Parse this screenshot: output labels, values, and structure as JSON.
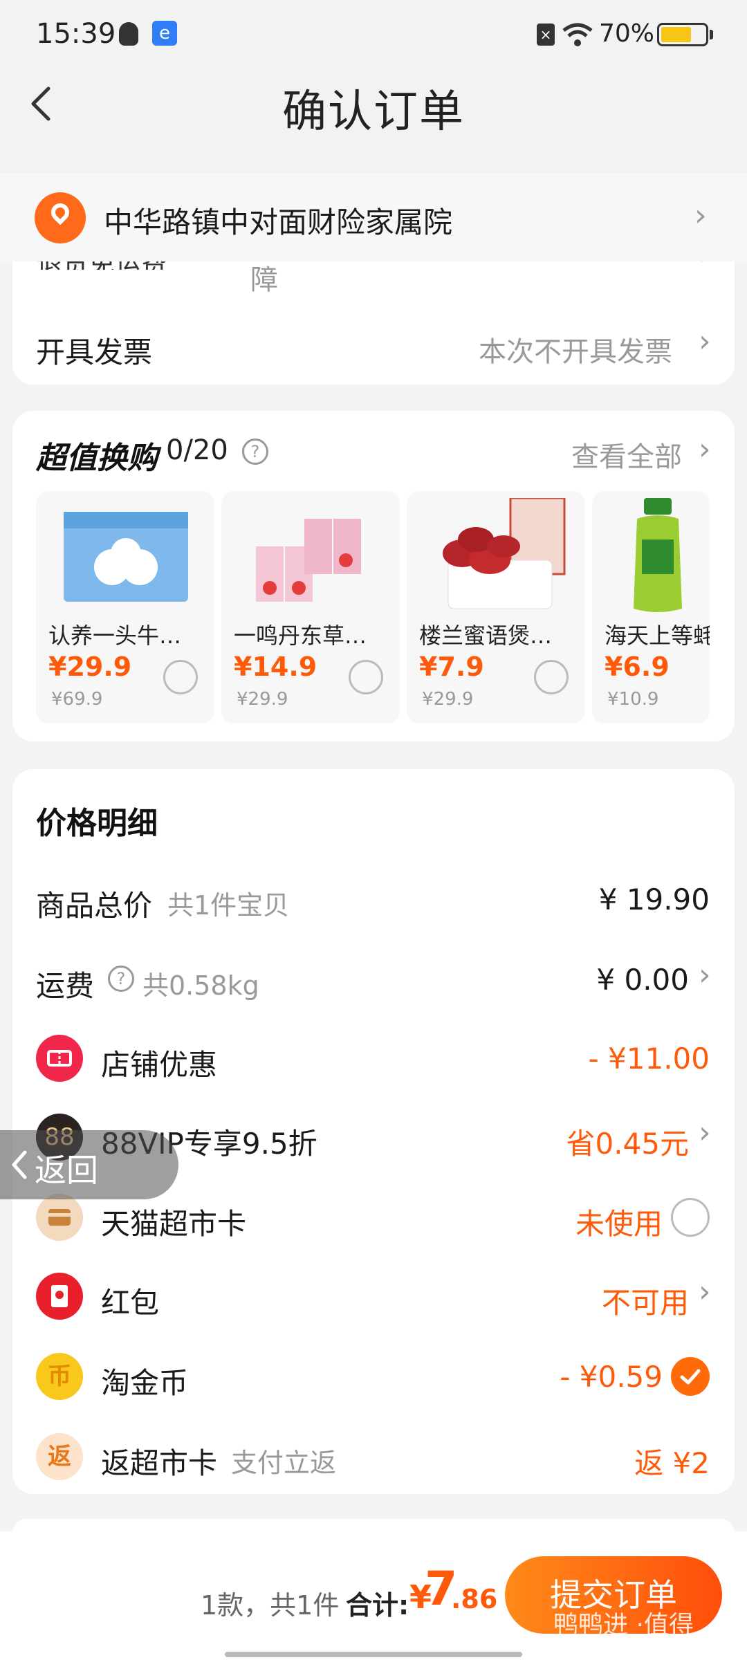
{
  "status": {
    "time": "15:39",
    "battery": "70%",
    "battery_level": 0.7
  },
  "nav": {
    "title": "确认订单"
  },
  "address": {
    "text": "中华路镇中对面财险家属院"
  },
  "services": {
    "partial_label": "退货免运费",
    "partial_value": "障",
    "invoice_label": "开具发票",
    "invoice_value": "本次不开具发票"
  },
  "deals": {
    "title": "超值换购",
    "count": "0/20",
    "view_all": "查看全部",
    "items": [
      {
        "name": "认养一头牛…",
        "price": "¥29.9",
        "orig": "¥69.9"
      },
      {
        "name": "一鸣丹东草…",
        "price": "¥14.9",
        "orig": "¥29.9"
      },
      {
        "name": "楼兰蜜语煲…",
        "price": "¥7.9",
        "orig": "¥29.9"
      },
      {
        "name": "海天上等蚝",
        "price": "¥6.9",
        "orig": "¥10.9"
      }
    ]
  },
  "price_detail": {
    "title": "价格明细",
    "rows": [
      {
        "label": "商品总价",
        "sub": "共1件宝贝",
        "value": "¥ 19.90"
      },
      {
        "label": "运费",
        "sub": "共0.58kg",
        "value": "¥ 0.00"
      },
      {
        "label": "店铺优惠",
        "value": "- ¥11.00"
      },
      {
        "label": "88VIP专享9.5折",
        "value": "省0.45元"
      },
      {
        "label": "天猫超市卡",
        "value": "未使用"
      },
      {
        "label": "红包",
        "value": "不可用"
      },
      {
        "label": "淘金币",
        "value": "- ¥0.59"
      },
      {
        "label": "返超市卡",
        "sub": "支付立返",
        "value": "返 ¥2"
      }
    ]
  },
  "float_back": {
    "label": "返回"
  },
  "bottom": {
    "summary": "1款，共1件",
    "total_label": "合计:",
    "currency": "¥",
    "total_int": "7",
    "total_dec": ".86",
    "submit": "提交订单",
    "watermark": "鸭鸭进 ·值得"
  },
  "colors": {
    "accent": "#ff5a0a",
    "background": "#f2f3f5"
  }
}
